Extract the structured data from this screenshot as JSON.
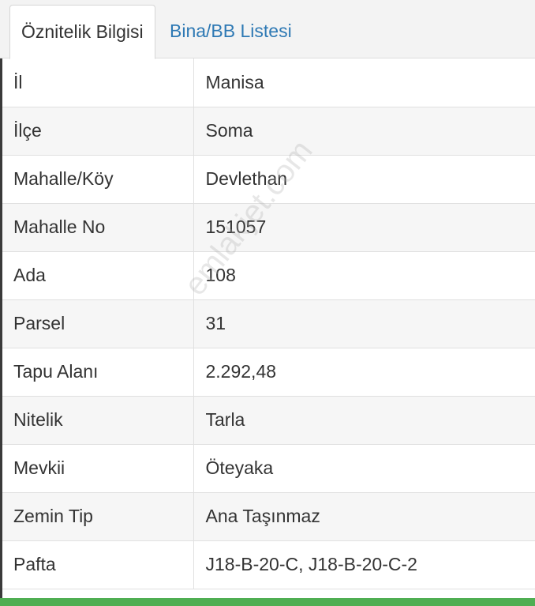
{
  "tabs": {
    "active_label": "Öznitelik Bilgisi",
    "second_label": "Bina/BB Listesi"
  },
  "rows": [
    {
      "key": "İl",
      "value": "Manisa"
    },
    {
      "key": "İlçe",
      "value": "Soma"
    },
    {
      "key": "Mahalle/Köy",
      "value": "Devlethan"
    },
    {
      "key": "Mahalle No",
      "value": "151057"
    },
    {
      "key": "Ada",
      "value": "108"
    },
    {
      "key": "Parsel",
      "value": "31"
    },
    {
      "key": "Tapu Alanı",
      "value": "2.292,48"
    },
    {
      "key": "Nitelik",
      "value": "Tarla"
    },
    {
      "key": "Mevkii",
      "value": "Öteyaka"
    },
    {
      "key": "Zemin Tip",
      "value": "Ana Taşınmaz"
    },
    {
      "key": "Pafta",
      "value": "J18-B-20-C, J18-B-20-C-2"
    }
  ],
  "watermark": "emlakjet.com",
  "colors": {
    "tab_link": "#2e79b4",
    "bottom_bar": "#4fae52"
  }
}
